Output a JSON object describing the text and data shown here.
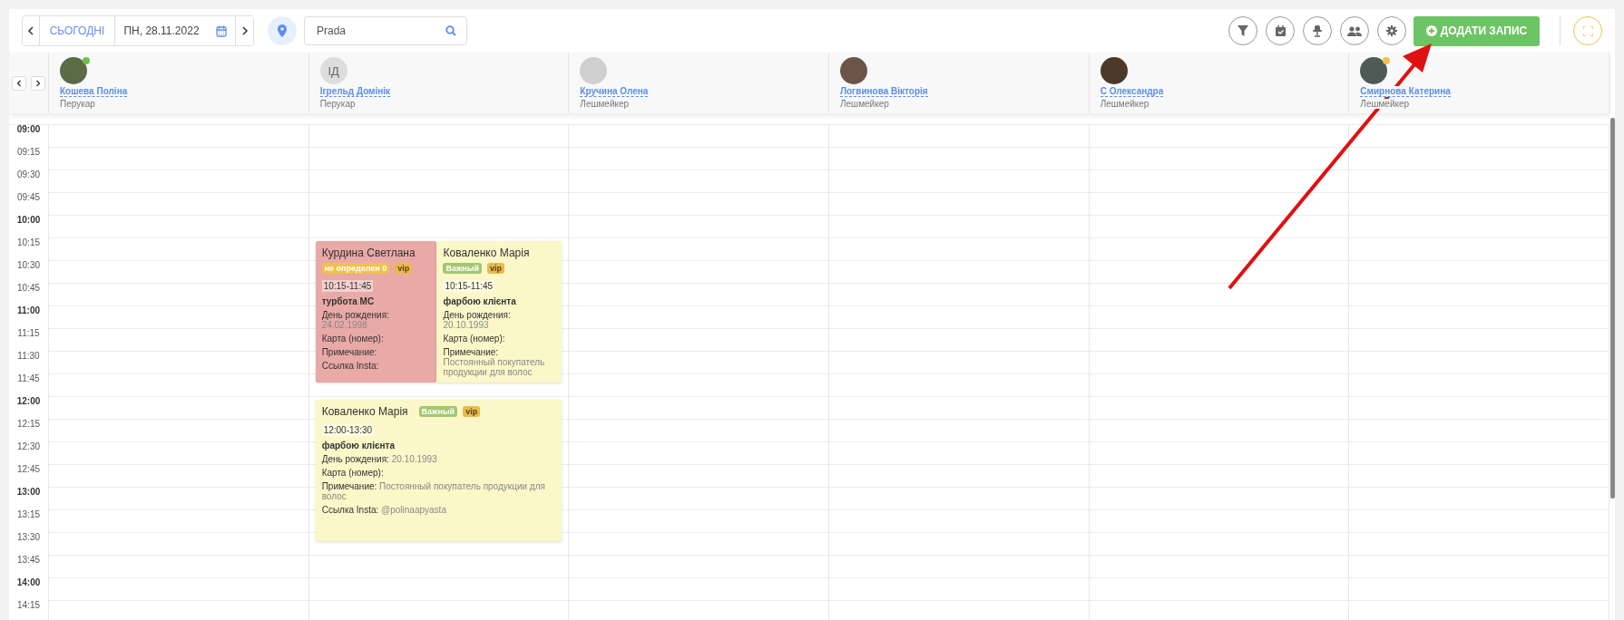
{
  "toolbar": {
    "today": "СЬОГОДНІ",
    "date": "ПН, 28.11.2022",
    "search": {
      "value": "Prada"
    },
    "add_button": "ДОДАТИ ЗАПИС"
  },
  "staff": [
    {
      "name": "Кошева Поліна",
      "role": "Перукар",
      "kind": "photo",
      "color": "#6cc04a"
    },
    {
      "name": "Ігрельд Домінік",
      "role": "Перукар",
      "kind": "initials",
      "initials": "ІД"
    },
    {
      "name": "Кручина Олена",
      "role": "Лешмейкер",
      "kind": "photo"
    },
    {
      "name": "Логвинова Вікторія",
      "role": "Лешмейкер",
      "kind": "photo"
    },
    {
      "name": "С Олександра",
      "role": "Лешмейкер",
      "kind": "photo"
    },
    {
      "name": "Смирнова Катерина",
      "role": "Лешмейкер",
      "kind": "photo",
      "color": "#f0c24a"
    }
  ],
  "times": [
    "09:00",
    "09:15",
    "09:30",
    "09:45",
    "10:00",
    "10:15",
    "10:30",
    "10:45",
    "11:00",
    "11:15",
    "11:30",
    "11:45",
    "12:00",
    "12:15",
    "12:30",
    "12:45",
    "13:00",
    "13:15",
    "13:30",
    "13:45",
    "14:00",
    "14:15"
  ],
  "events": [
    {
      "kind": "narrow",
      "color": "#e9a9a6",
      "client": "Курдина Светлана",
      "tags": [
        {
          "label": "не определен 0",
          "color": "#f0c24a"
        },
        {
          "label": "vip",
          "color": "#e9b94f"
        }
      ],
      "time": "10:15-11:45",
      "service": "турбота МС",
      "fields": [
        {
          "label": "День рождения:",
          "value": "24.02.1998"
        },
        {
          "label": "Карта (номер):"
        },
        {
          "label": "Примечание:"
        },
        {
          "label": "Ссылка Insta:"
        }
      ]
    },
    {
      "kind": "narrow",
      "color": "#fbf7c8",
      "client": "Коваленко Марія",
      "tags": [
        {
          "label": "Важный",
          "color": "#a3c76f"
        },
        {
          "label": "vip",
          "color": "#e9b94f"
        }
      ],
      "time": "10:15-11:45",
      "service": "фарбою клієнта",
      "fields": [
        {
          "label": "День рождения:",
          "value": "20.10.1993"
        },
        {
          "label": "Карта (номер):"
        },
        {
          "label": "Примечание:",
          "value": "Постоянный покупатель продукции для волос"
        }
      ]
    },
    {
      "kind": "wide",
      "color": "#fbf7c8",
      "client": "Коваленко Марія",
      "tags": [
        {
          "label": "Важный",
          "color": "#a3c76f"
        },
        {
          "label": "vip",
          "color": "#e9b94f"
        }
      ],
      "time": "12:00-13:30",
      "service": "фарбою клієнта",
      "fields": [
        {
          "label": "День рождения:",
          "value": "20.10.1993"
        },
        {
          "label": "Карта (номер):"
        },
        {
          "label": "Примечание:",
          "value": "Постоянный покупатель продукции для волос"
        },
        {
          "label": "Ссылка Insta:",
          "value": "@polinaapyasta"
        }
      ]
    }
  ]
}
